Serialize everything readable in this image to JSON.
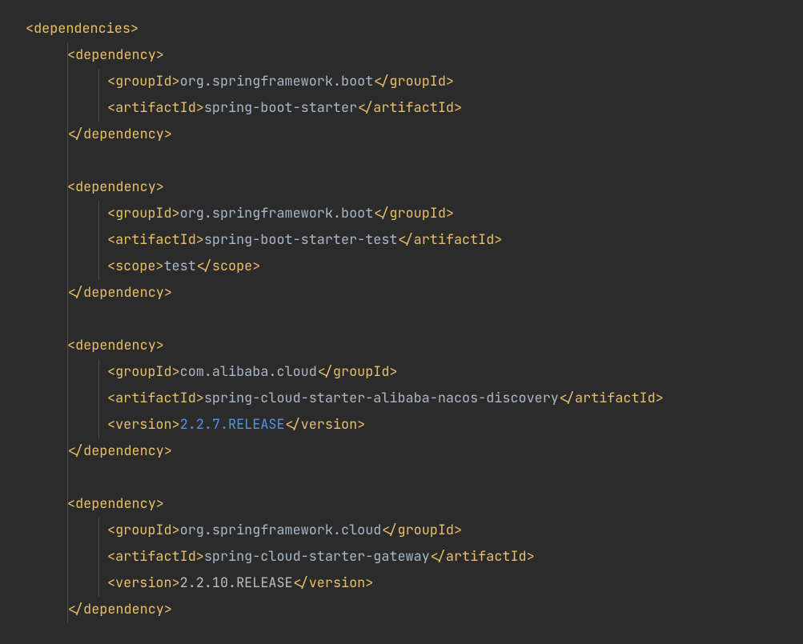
{
  "rootTag": "dependencies",
  "dependencies": [
    {
      "lines": [
        {
          "type": "open",
          "tag": "dependency"
        },
        {
          "type": "leaf",
          "tag": "groupId",
          "text": "org.springframework.boot",
          "cls": "text"
        },
        {
          "type": "leaf",
          "tag": "artifactId",
          "text": "spring-boot-starter",
          "cls": "text"
        },
        {
          "type": "close",
          "tag": "dependency"
        }
      ]
    },
    {
      "lines": [
        {
          "type": "open",
          "tag": "dependency"
        },
        {
          "type": "leaf",
          "tag": "groupId",
          "text": "org.springframework.boot",
          "cls": "text"
        },
        {
          "type": "leaf",
          "tag": "artifactId",
          "text": "spring-boot-starter-test",
          "cls": "text"
        },
        {
          "type": "leaf",
          "tag": "scope",
          "text": "test",
          "cls": "text"
        },
        {
          "type": "close",
          "tag": "dependency"
        }
      ]
    },
    {
      "lines": [
        {
          "type": "open",
          "tag": "dependency"
        },
        {
          "type": "leaf",
          "tag": "groupId",
          "text": "com.alibaba.cloud",
          "cls": "text"
        },
        {
          "type": "leaf",
          "tag": "artifactId",
          "text": "spring-cloud-starter-alibaba-nacos-discovery",
          "cls": "text"
        },
        {
          "type": "leaf",
          "tag": "version",
          "text": "2.2.7.RELEASE",
          "cls": "version-hl"
        },
        {
          "type": "close",
          "tag": "dependency"
        }
      ]
    },
    {
      "lines": [
        {
          "type": "open",
          "tag": "dependency"
        },
        {
          "type": "leaf",
          "tag": "groupId",
          "text": "org.springframework.cloud",
          "cls": "text"
        },
        {
          "type": "leaf",
          "tag": "artifactId",
          "text": "spring-cloud-starter-gateway",
          "cls": "text"
        },
        {
          "type": "leaf",
          "tag": "version",
          "text": "2.2.10.RELEASE",
          "cls": "value"
        },
        {
          "type": "close",
          "tag": "dependency"
        }
      ]
    }
  ]
}
